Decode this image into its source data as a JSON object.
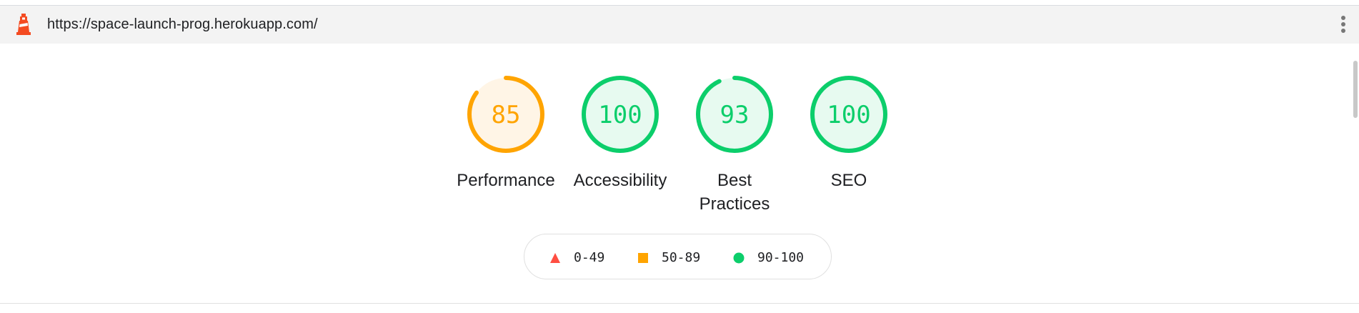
{
  "toolbar": {
    "url": "https://space-launch-prog.herokuapp.com/",
    "logo_icon": "lighthouse-icon",
    "menu_icon": "more-vertical-icon"
  },
  "gauges": [
    {
      "label": "Performance",
      "score": "85",
      "fill": 0.85,
      "color": "#ffa400",
      "bg": "#fff5e6"
    },
    {
      "label": "Accessibility",
      "score": "100",
      "fill": 1.0,
      "color": "#0cce6b",
      "bg": "#e7faf0"
    },
    {
      "label_line1": "Best",
      "label_line2": "Practices",
      "score": "93",
      "fill": 0.93,
      "color": "#0cce6b",
      "bg": "#e7faf0"
    },
    {
      "label": "SEO",
      "score": "100",
      "fill": 1.0,
      "color": "#0cce6b",
      "bg": "#e7faf0"
    }
  ],
  "legend": {
    "fail": {
      "range": "0-49",
      "color": "#ff4e42",
      "icon": "triangle-icon"
    },
    "average": {
      "range": "50-89",
      "color": "#ffa400",
      "icon": "square-icon"
    },
    "pass": {
      "range": "90-100",
      "color": "#0cce6b",
      "icon": "circle-icon"
    }
  }
}
